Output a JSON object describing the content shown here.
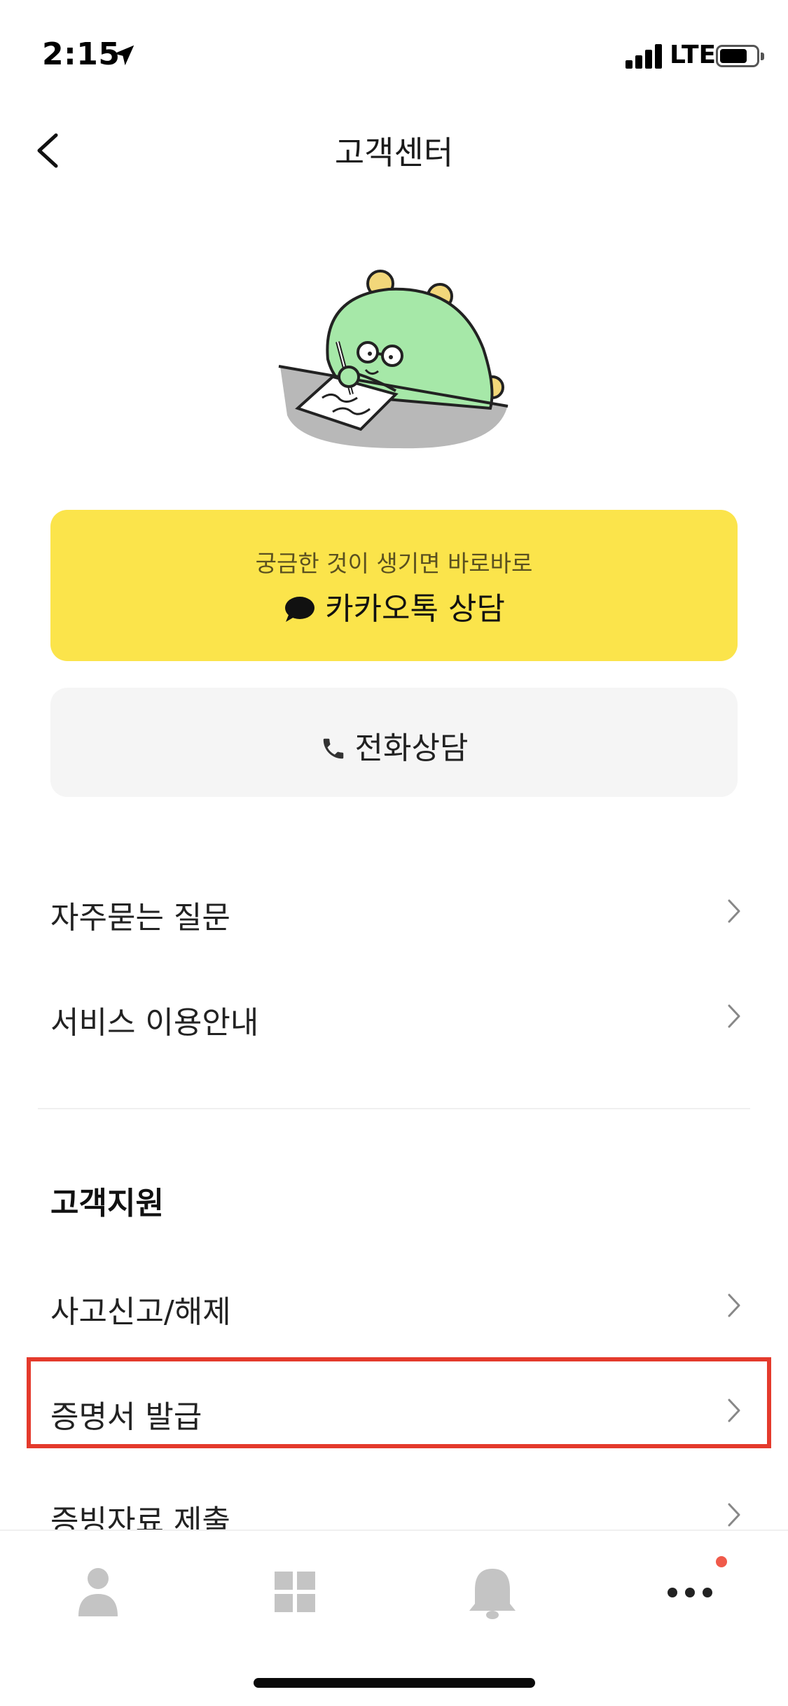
{
  "status_bar": {
    "time": "2:15",
    "network": "LTE",
    "battery_level": 0.7
  },
  "header": {
    "title": "고객센터"
  },
  "contact": {
    "kakao_subtitle": "궁금한 것이 생기면 바로바로",
    "kakao_label": "카카오톡 상담",
    "phone_label": "전화상담"
  },
  "help_list": [
    {
      "label": "자주묻는 질문"
    },
    {
      "label": "서비스 이용안내"
    }
  ],
  "support_section": {
    "title": "고객지원",
    "items": [
      {
        "label": "사고신고/해제"
      },
      {
        "label": "증명서 발급"
      },
      {
        "label": "증빙자료 제출"
      }
    ]
  },
  "bottom_nav": {
    "items": [
      "person-icon",
      "grid-icon",
      "bell-icon",
      "more-icon"
    ],
    "notification_dot_color": "#f05a4a"
  },
  "colors": {
    "kakao_yellow": "#fbe44b",
    "highlight_red": "#e43a2c",
    "character_green": "#a6e8a8"
  }
}
